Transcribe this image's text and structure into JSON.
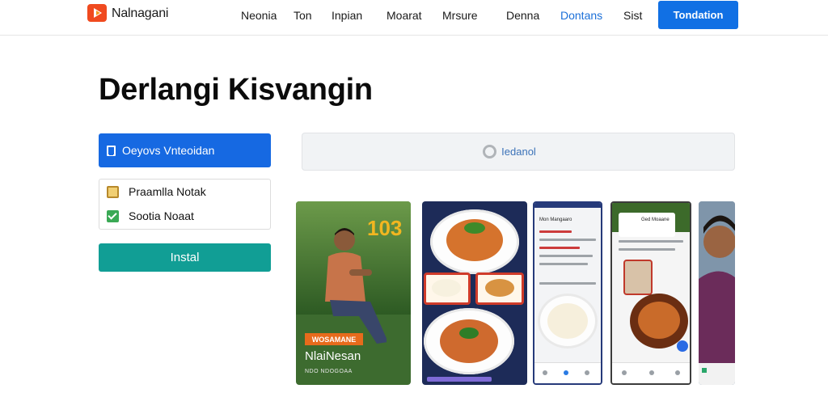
{
  "header": {
    "brand": "Nalnagani",
    "nav": [
      "Neonia",
      "Ton",
      "Inpian",
      "Moarat",
      "Mrsure",
      "Denna",
      "Dontans",
      "Sist"
    ],
    "active_nav": "Dontans",
    "cta": "Tondation"
  },
  "hero": {
    "title": "Derlangi Kisvangin",
    "primary_button": "Oeyovs Vnteoidan",
    "options": [
      {
        "label": "Praamlla Notak"
      },
      {
        "label": "Sootia Noaat"
      }
    ],
    "install_button": "Instal"
  },
  "search": {
    "placeholder": "Iedanol"
  },
  "cards": {
    "card1_title": "NlaiNesan",
    "card1_badge": "WOSAMANE",
    "card1_number": "103",
    "card1_sub": "NDO NDOGOAA",
    "card3_title": "Mon Mangaaro",
    "card4_title": "Ged Moaane"
  },
  "colors": {
    "accent": "#1170e4",
    "install": "#119e95",
    "active_nav": "#1b6fd8"
  }
}
